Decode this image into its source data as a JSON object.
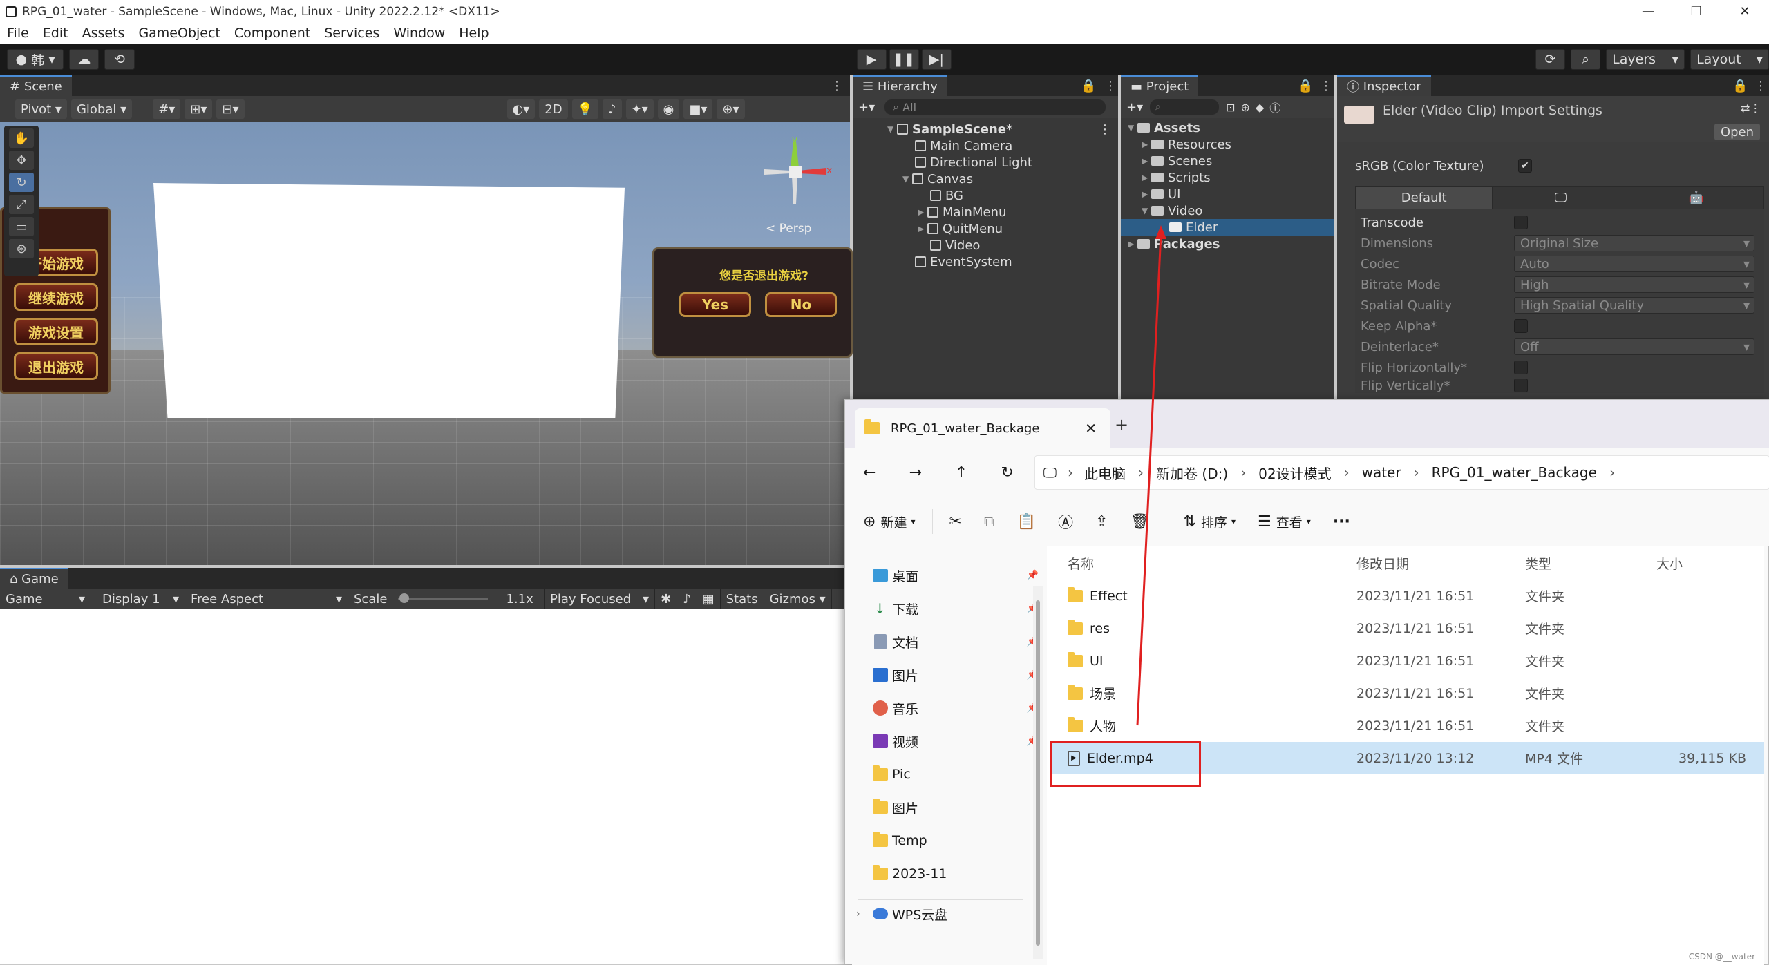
{
  "window": {
    "title": "RPG_01_water - SampleScene - Windows, Mac, Linux - Unity 2022.2.12* <DX11>",
    "controls": [
      "—",
      "❐",
      "✕"
    ]
  },
  "menu": [
    "File",
    "Edit",
    "Assets",
    "GameObject",
    "Component",
    "Services",
    "Window",
    "Help"
  ],
  "toolbar": {
    "account": "韩",
    "layers": "Layers",
    "layout": "Layout"
  },
  "scene": {
    "tab": "Scene",
    "pivot": "Pivot",
    "global": "Global",
    "mode_2d": "2D",
    "persp": "< Persp",
    "game_buttons": [
      "开始游戏",
      "继续游戏",
      "游戏设置",
      "退出游戏"
    ],
    "quit_prompt": "您是否退出游戏?",
    "quit_yes": "Yes",
    "quit_no": "No",
    "gizmo_y": "y",
    "gizmo_x": "x"
  },
  "game": {
    "tab": "Game",
    "mode": "Game",
    "display": "Display 1",
    "aspect": "Free Aspect",
    "scale_label": "Scale",
    "scale_value": "1.1x",
    "play_focused": "Play Focused",
    "stats": "Stats",
    "gizmos": "Gizmos"
  },
  "hierarchy": {
    "tab": "Hierarchy",
    "search_placeholder": "All",
    "items": [
      {
        "label": "SampleScene*"
      },
      {
        "label": "Main Camera"
      },
      {
        "label": "Directional Light"
      },
      {
        "label": "Canvas"
      },
      {
        "label": "BG"
      },
      {
        "label": "MainMenu"
      },
      {
        "label": "QuitMenu"
      },
      {
        "label": "Video"
      },
      {
        "label": "EventSystem"
      }
    ]
  },
  "project": {
    "tab": "Project",
    "items": [
      {
        "label": "Assets"
      },
      {
        "label": "Resources"
      },
      {
        "label": "Scenes"
      },
      {
        "label": "Scripts"
      },
      {
        "label": "UI"
      },
      {
        "label": "Video"
      },
      {
        "label": "Elder"
      },
      {
        "label": "Packages"
      }
    ]
  },
  "inspector": {
    "tab": "Inspector",
    "title": "Elder (Video Clip) Import Settings",
    "open_button": "Open",
    "srgb_label": "sRGB (Color Texture)",
    "platform_tab": "Default",
    "rows": [
      {
        "label": "Transcode",
        "value": ""
      },
      {
        "label": "Dimensions",
        "value": "Original Size"
      },
      {
        "label": "Codec",
        "value": "Auto"
      },
      {
        "label": "Bitrate Mode",
        "value": "High"
      },
      {
        "label": "Spatial Quality",
        "value": "High Spatial Quality"
      },
      {
        "label": "Keep Alpha*",
        "value": ""
      },
      {
        "label": "Deinterlace*",
        "value": "Off"
      },
      {
        "label": "Flip Horizontally*",
        "value": ""
      },
      {
        "label": "Flip Vertically*",
        "value": ""
      }
    ]
  },
  "explorer": {
    "tab_title": "RPG_01_water_Backage",
    "new_tab": "+",
    "breadcrumb": [
      "此电脑",
      "新加卷 (D:)",
      "02设计模式",
      "water",
      "RPG_01_water_Backage"
    ],
    "cmd_new": "新建",
    "cmd_sort": "排序",
    "cmd_view": "查看",
    "cmd_more": "···",
    "sidebar": [
      "桌面",
      "下载",
      "文档",
      "图片",
      "音乐",
      "视频",
      "Pic",
      "图片",
      "Temp",
      "2023-11",
      "WPS云盘"
    ],
    "columns": {
      "name": "名称",
      "date": "修改日期",
      "type": "类型",
      "size": "大小"
    },
    "rows": [
      {
        "name": "Effect",
        "date": "2023/11/21 16:51",
        "type": "文件夹",
        "size": ""
      },
      {
        "name": "res",
        "date": "2023/11/21 16:51",
        "type": "文件夹",
        "size": ""
      },
      {
        "name": "UI",
        "date": "2023/11/21 16:51",
        "type": "文件夹",
        "size": ""
      },
      {
        "name": "场景",
        "date": "2023/11/21 16:51",
        "type": "文件夹",
        "size": ""
      },
      {
        "name": "人物",
        "date": "2023/11/21 16:51",
        "type": "文件夹",
        "size": ""
      },
      {
        "name": "Elder.mp4",
        "date": "2023/11/20 13:12",
        "type": "MP4 文件",
        "size": "39,115 KB"
      }
    ]
  },
  "credit": "CSDN @__water"
}
